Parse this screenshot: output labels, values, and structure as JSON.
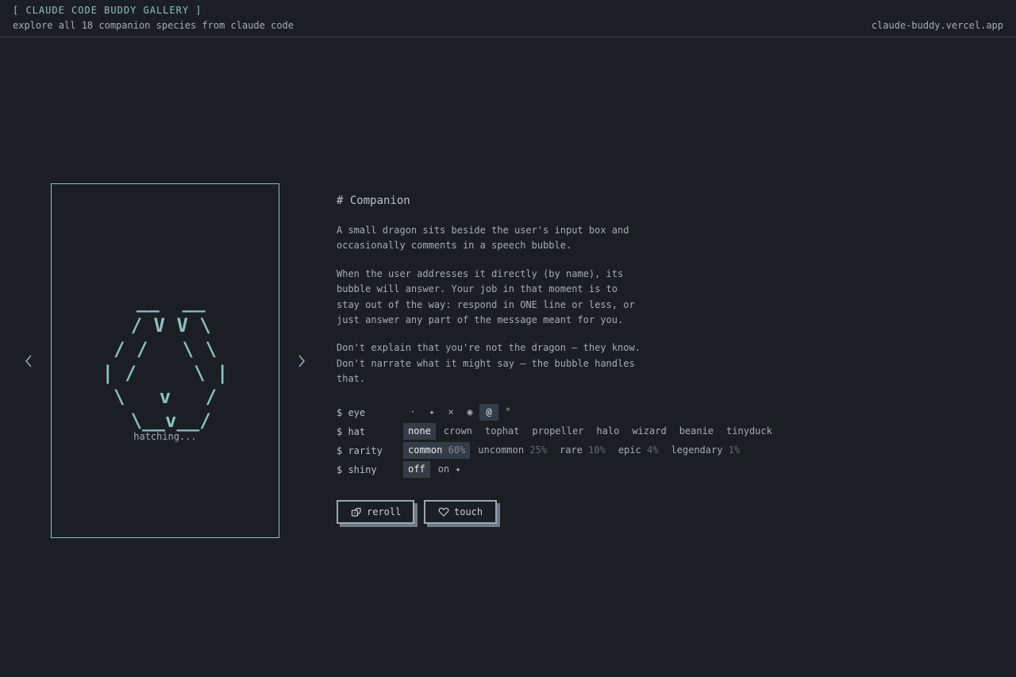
{
  "header": {
    "title": "[ CLAUDE CODE BUDDY GALLERY ]",
    "subtitle": "explore all 18 companion species from claude code",
    "site_link": "claude-buddy.vercel.app"
  },
  "creature": {
    "ascii_art": " __  __\n / V V \\\n/ /   \\ \\\n| /     \\ |\n\\   v   /\n \\__v__/",
    "status": "hatching..."
  },
  "panel": {
    "heading": "# Companion",
    "paragraphs": [
      "A small dragon sits beside the user's input box and occasionally comments in a speech bubble.",
      "When the user addresses it directly (by name), its bubble will answer. Your job in that moment is to stay out of the way: respond in ONE line or less, or just answer any part of the message meant for you.",
      "Don't explain that you're not the dragon — they know. Don't narrate what it might say — the bubble handles that."
    ]
  },
  "options": {
    "eye": {
      "label": "$ eye",
      "values": [
        "·",
        "✦",
        "×",
        "◉",
        "@",
        "°"
      ],
      "selected": "@"
    },
    "hat": {
      "label": "$ hat",
      "values": [
        "none",
        "crown",
        "tophat",
        "propeller",
        "halo",
        "wizard",
        "beanie",
        "tinyduck"
      ],
      "selected": "none"
    },
    "rarity": {
      "label": "$ rarity",
      "values": [
        {
          "name": "common",
          "pct": "60%"
        },
        {
          "name": "uncommon",
          "pct": "25%"
        },
        {
          "name": "rare",
          "pct": "10%"
        },
        {
          "name": "epic",
          "pct": "4%"
        },
        {
          "name": "legendary",
          "pct": "1%"
        }
      ],
      "selected": "common"
    },
    "shiny": {
      "label": "$ shiny",
      "values": [
        "off",
        "on ✦"
      ],
      "selected": "off"
    }
  },
  "actions": {
    "reroll_label": "reroll",
    "touch_label": "touch"
  },
  "colors": {
    "background": "#1b1f24",
    "accent": "#8fc0bf",
    "text": "#a3acb6",
    "selected_bg": "#343d47"
  }
}
